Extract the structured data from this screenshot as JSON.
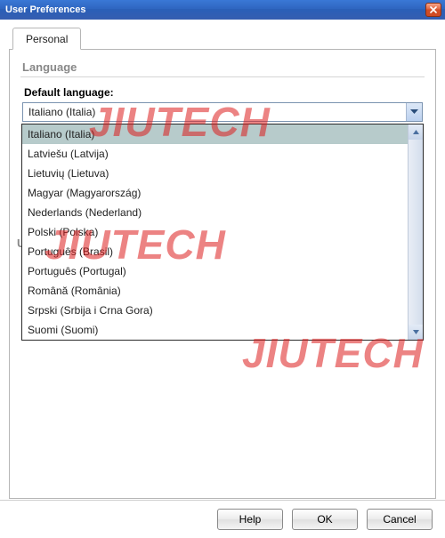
{
  "window": {
    "title": "User Preferences"
  },
  "tabs": {
    "personal": "Personal"
  },
  "section": {
    "language_heading": "Language",
    "default_language_label": "Default language:"
  },
  "combo": {
    "selected": "Italiano (Italia)"
  },
  "dropdown": {
    "items": [
      "Italiano (Italia)",
      "Latviešu (Latvija)",
      "Lietuvių (Lietuva)",
      "Magyar (Magyarország)",
      "Nederlands (Nederland)",
      "Polski (Polska)",
      "Português (Brasil)",
      "Português (Portugal)",
      "Română (România)",
      "Srpski (Srbija i Crna Gora)",
      "Suomi (Suomi)"
    ],
    "selected_index": 0
  },
  "obscured_label_initial": "U",
  "buttons": {
    "help": "Help",
    "ok": "OK",
    "cancel": "Cancel"
  },
  "watermark": "JIUTECH"
}
